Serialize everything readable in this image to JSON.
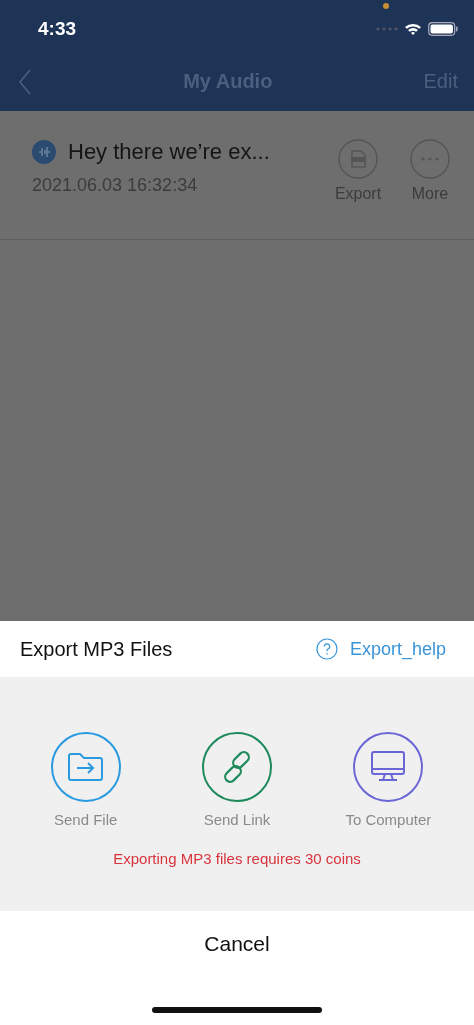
{
  "status_bar": {
    "time": "4:33"
  },
  "nav_bar": {
    "title": "My Audio",
    "action": "Edit"
  },
  "recordings": [
    {
      "title": "Hey there we’re ex...",
      "date": "2021.06.03 16:32:34",
      "actions": [
        {
          "kind": "export",
          "label": "Export"
        },
        {
          "kind": "more",
          "label": "More"
        }
      ]
    }
  ],
  "sheet": {
    "title": "Export MP3 Files",
    "help_link": "Export_help",
    "options": [
      {
        "kind": "file",
        "label": "Send File",
        "color": "#2a9ae0"
      },
      {
        "kind": "link",
        "label": "Send Link",
        "color": "#1e8a5c"
      },
      {
        "kind": "computer",
        "label": "To Computer",
        "color": "#6b66d6"
      }
    ],
    "notice": "Exporting MP3 files requires 30 coins",
    "cancel": "Cancel"
  }
}
